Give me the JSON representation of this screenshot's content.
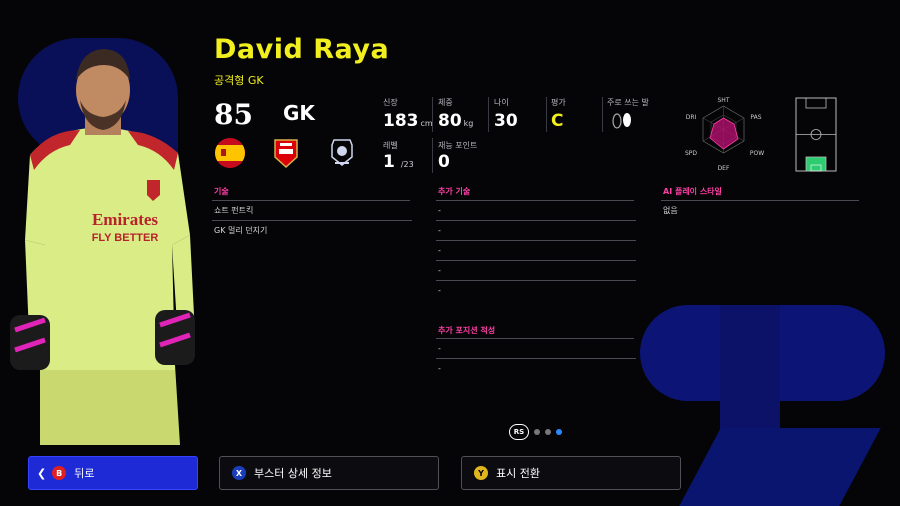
{
  "player": {
    "name": "David Raya",
    "play_style": "공격형 GK",
    "rating": "85",
    "position": "GK"
  },
  "stats": {
    "height_label": "신장",
    "height": "183",
    "height_unit": "cm",
    "weight_label": "체중",
    "weight": "80",
    "weight_unit": "kg",
    "age_label": "나이",
    "age": "30",
    "grade_label": "평가",
    "grade": "C",
    "foot_label": "주로 쓰는 발",
    "level_label": "레벨",
    "level": "1",
    "level_max": "/23",
    "points_label": "재능 포인트",
    "points": "0"
  },
  "skills": {
    "title": "기술",
    "items": [
      "쇼트 펀트킥",
      "GK 멀리 던지기"
    ]
  },
  "additional_skills": {
    "title": "추가 기술",
    "items": [
      "-",
      "-",
      "-",
      "-",
      "-"
    ]
  },
  "additional_positions": {
    "title": "추가 포지션 적성",
    "items": [
      "-",
      "-"
    ]
  },
  "ai_style": {
    "title": "AI 플레이 스타일",
    "items": [
      "없음"
    ]
  },
  "radar": {
    "labels": {
      "top": "SHT",
      "left_top": "DRI",
      "right_top": "PAS",
      "left_bottom": "SPD",
      "right_bottom": "POW",
      "bottom": "DEF"
    }
  },
  "pager": {
    "label": "RS",
    "pages": 3,
    "active": 3
  },
  "buttons": {
    "back_key": "B",
    "back": "뒤로",
    "booster_key": "X",
    "booster": "부스터 상세 정보",
    "toggle_key": "Y",
    "toggle": "표시 전환"
  },
  "colors": {
    "accent_yellow": "#f2ef1f",
    "accent_pink": "#ff3fa6",
    "button_blue": "#1d2ad6"
  }
}
